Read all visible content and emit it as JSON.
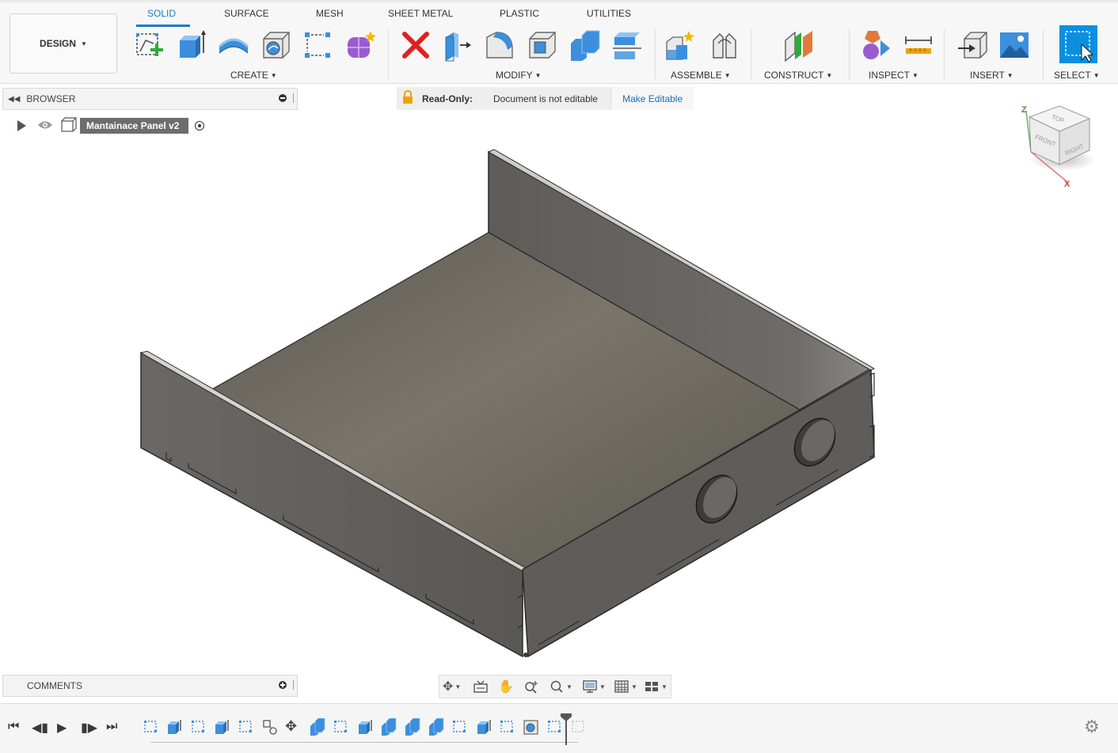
{
  "design_button": {
    "label": "DESIGN"
  },
  "tabs": [
    {
      "label": "SOLID",
      "active": true
    },
    {
      "label": "SURFACE"
    },
    {
      "label": "MESH"
    },
    {
      "label": "SHEET METAL"
    },
    {
      "label": "PLASTIC"
    },
    {
      "label": "UTILITIES"
    }
  ],
  "groups": {
    "create": "CREATE",
    "modify": "MODIFY",
    "assemble": "ASSEMBLE",
    "construct": "CONSTRUCT",
    "inspect": "INSPECT",
    "insert": "INSERT",
    "select": "SELECT"
  },
  "browser": {
    "title": "BROWSER",
    "document_name": "Mantainace Panel v2"
  },
  "readonly": {
    "label": "Read-Only:",
    "message": "Document is not editable",
    "action": "Make Editable"
  },
  "viewcube": {
    "top": "TOP",
    "front": "FRONT",
    "right": "RIGHT",
    "axis_z": "Z",
    "axis_x": "X"
  },
  "comments": {
    "title": "COMMENTS"
  },
  "colors": {
    "accent": "#1a7bc6",
    "tool_blue": "#3c8fdc",
    "delete_red": "#e02020",
    "model_gray": "#6b675f",
    "lock_orange": "#f0a000"
  },
  "icons": {
    "collapse": "double-chevron-left-icon",
    "visibility": "eye-icon",
    "component": "component-box-icon",
    "settings": "gear-icon"
  }
}
